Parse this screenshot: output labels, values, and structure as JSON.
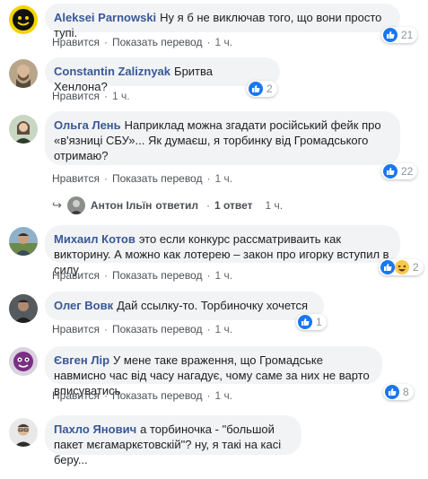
{
  "comments": [
    {
      "author": "Aleksei Parnowski",
      "text": "Ну я б не виключав того, що вони просто тупі.",
      "actions": [
        "Нравится",
        "Показать перевод",
        "1 ч."
      ],
      "reactions": "21",
      "avatar": "yellow-face-avatar"
    },
    {
      "author": "Constantin Zaliznyak",
      "text": "Бритва Хенлона?",
      "actions": [
        "Нравится",
        "1 ч."
      ],
      "reactions": "2",
      "avatar": "bearded-man-avatar"
    },
    {
      "author": "Ольга Лень",
      "text": "Наприклад можна згадати російський фейк про «в'язниці СБУ»... Як думаєш, я торбинку від Громадського отримаю?",
      "actions": [
        "Нравится",
        "Показать перевод",
        "1 ч."
      ],
      "reactions": "22",
      "avatar": "woman-avatar"
    },
    {
      "author": "Михаил Котов",
      "text": "это если конкурс рассматриваить как викторину. А можно как лотерею – закон про игорку вступил в силу",
      "actions": [
        "Нравится",
        "Показать перевод",
        "1 ч."
      ],
      "reactions": "2",
      "avatar": "man-outdoor-avatar"
    },
    {
      "author": "Олег Вовк",
      "text": "Дай ссылку-то. Торбиночку хочется",
      "actions": [
        "Нравится",
        "Показать перевод",
        "1 ч."
      ],
      "reactions": "1",
      "avatar": "man-dark-avatar"
    },
    {
      "author": "Євген Лір",
      "text": "У мене таке враження, що Громадське навмисно час від часу нагадує, чому саме за них не варто вписуватись",
      "actions": [
        "Нравится",
        "Показать перевод",
        "1 ч."
      ],
      "reactions": "8",
      "avatar": "purple-character-avatar"
    },
    {
      "author": "Пахло Янович",
      "text": "а торбиночка - \"большой пакет мєгамаркєтовскій\"? ну, я такі на касі беру...",
      "actions": [],
      "reactions": "",
      "avatar": "man-glasses-avatar"
    }
  ],
  "reply": {
    "name": "Антон Ільїн",
    "verb": "ответил",
    "count": "1 ответ",
    "time": "1 ч."
  }
}
